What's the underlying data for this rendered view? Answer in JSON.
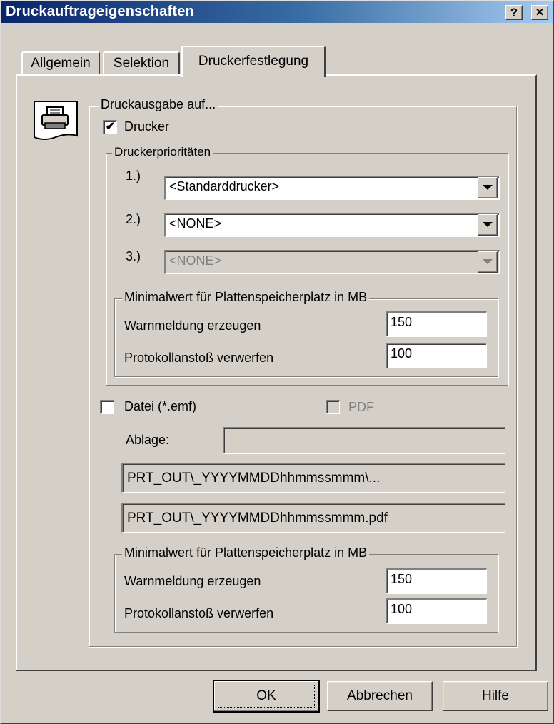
{
  "window": {
    "title": "Druckauftrageigenschaften",
    "help_button": "?",
    "close_button": "✕"
  },
  "tabs": [
    {
      "label": "Allgemein"
    },
    {
      "label": "Selektion"
    },
    {
      "label": "Druckerfestlegung"
    }
  ],
  "printer_icon": "printer-icon",
  "output": {
    "legend": "Druckausgabe auf...",
    "printer_checkbox": {
      "label": "Drucker",
      "checked": true,
      "mark": "✔"
    },
    "priorities": {
      "legend": "Druckerprioritäten",
      "rows": [
        {
          "label": "1.)",
          "value": "<Standarddrucker>",
          "enabled": true
        },
        {
          "label": "2.)",
          "value": "<NONE>",
          "enabled": true
        },
        {
          "label": "3.)",
          "value": "<NONE>",
          "enabled": false
        }
      ],
      "min_space": {
        "legend": "Minimalwert für Plattenspeicherplatz in MB",
        "warn_label": "Warnmeldung erzeugen",
        "warn_value": "150",
        "discard_label": "Protokollanstoß verwerfen",
        "discard_value": "100"
      }
    },
    "file_checkbox": {
      "label": "Datei  (*.emf)",
      "checked": false
    },
    "pdf_checkbox": {
      "label": "PDF",
      "checked": false,
      "enabled": false
    },
    "storage": {
      "label": "Ablage:",
      "value": ""
    },
    "path_emf": "PRT_OUT\\_YYYYMMDDhhmmssmmm\\...",
    "path_pdf": "PRT_OUT\\_YYYYMMDDhhmmssmmm.pdf",
    "file_min_space": {
      "legend": "Minimalwert für Plattenspeicherplatz in MB",
      "warn_label": "Warnmeldung erzeugen",
      "warn_value": "150",
      "discard_label": "Protokollanstoß verwerfen",
      "discard_value": "100"
    }
  },
  "buttons": {
    "ok": "OK",
    "cancel": "Abbrechen",
    "help": "Hilfe"
  },
  "colors": {
    "title_gradient_start": "#0a246a",
    "title_gradient_end": "#a6caf0",
    "face": "#d4d0c8"
  }
}
